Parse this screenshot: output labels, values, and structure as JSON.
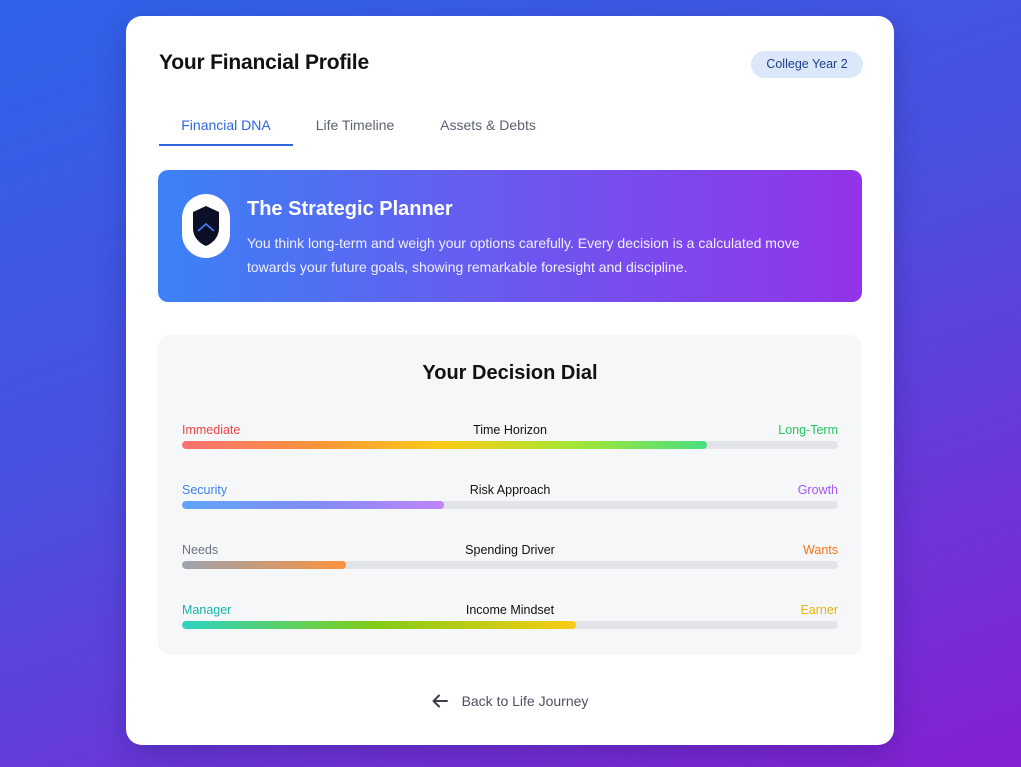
{
  "header": {
    "title": "Your Financial Profile",
    "badge": "College Year 2"
  },
  "tabs": [
    {
      "label": "Financial DNA",
      "active": true
    },
    {
      "label": "Life Timeline",
      "active": false
    },
    {
      "label": "Assets & Debts",
      "active": false
    }
  ],
  "profile": {
    "icon": "shield-icon",
    "title": "The Strategic Planner",
    "description": "You think long-term and weigh your options carefully. Every decision is a calculated move towards your future goals, showing remarkable foresight and discipline."
  },
  "dial": {
    "title": "Your Decision Dial",
    "rows": [
      {
        "left": "Immediate",
        "center": "Time Horizon",
        "right": "Long-Term",
        "value": 0.8,
        "left_color": "#ef4444",
        "right_color": "#22c55e",
        "gradient": [
          "#f87171",
          "#fb923c",
          "#facc15",
          "#a3e635",
          "#4ade80"
        ]
      },
      {
        "left": "Security",
        "center": "Risk Approach",
        "right": "Growth",
        "value": 0.4,
        "left_color": "#3b82f6",
        "right_color": "#a855f7",
        "gradient": [
          "#60a5fa",
          "#818cf8",
          "#c084fc"
        ]
      },
      {
        "left": "Needs",
        "center": "Spending Driver",
        "right": "Wants",
        "value": 0.25,
        "left_color": "#6b7280",
        "right_color": "#f97316",
        "gradient": [
          "#9ca3af",
          "#fb923c"
        ]
      },
      {
        "left": "Manager",
        "center": "Income Mindset",
        "right": "Earner",
        "value": 0.6,
        "left_color": "#14b8a6",
        "right_color": "#eab308",
        "gradient": [
          "#2dd4bf",
          "#84cc16",
          "#facc15"
        ]
      }
    ]
  },
  "footer": {
    "back_icon": "arrow-left-icon",
    "back_label": "Back to Life Journey"
  }
}
